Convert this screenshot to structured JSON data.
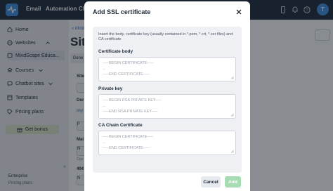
{
  "topbar": {
    "nav": [
      "Email",
      "Automation",
      "Ch"
    ],
    "avatar_initial": "T"
  },
  "sidebar": {
    "items": [
      {
        "label": "Home",
        "icon": "home-icon"
      },
      {
        "label": "Websites",
        "icon": "globe-icon"
      },
      {
        "label": "MindScape Educa...",
        "icon": "site-icon"
      },
      {
        "label": "Courses",
        "icon": "courses-icon"
      },
      {
        "label": "Chatbot sites",
        "icon": "chatbot-icon"
      },
      {
        "label": "Templates",
        "icon": "templates-icon"
      },
      {
        "label": "Pricing plans",
        "icon": "pricing-icon"
      }
    ],
    "bonus_label": "Get bonus",
    "plan_name": "Enterprise",
    "plan_link": "Pricing plans",
    "collapse": "«"
  },
  "main": {
    "breadcrumb": "« Mind",
    "title": "Sit",
    "tab": "Gene",
    "fields": [
      {
        "label": "Site",
        "top": 0
      },
      {
        "label": "Dor"
      },
      {
        "link": "psy"
      },
      {
        "label": "Mai"
      },
      {
        "label": "404"
      }
    ],
    "box_values": [
      "p",
      "N",
      "N"
    ],
    "gray_text": "Ope"
  },
  "modal": {
    "title": "Add SSL certificate",
    "instructions": "Insert the body, certificate key (usually contained in *.pem, *.crt, *.cer files) and CA certificate",
    "fields": [
      {
        "label": "Certificate body",
        "placeholder": "-----BEGIN CERTIFICATE-----\n...\n-----END CERTIFICATE-----"
      },
      {
        "label": "Private key",
        "placeholder": "-----BEGIN RSA PRIVATE KEY-----\n...\n-----END RSA PRIVATE KEY-----"
      },
      {
        "label": "CA Chain Certificate",
        "placeholder": "-----BEGIN CERTIFICATE-----\n...\n-----END CERTIFICATE-----"
      }
    ],
    "cancel_label": "Cancel",
    "add_label": "Add"
  },
  "colors": {
    "topbar": "#1d2a3a",
    "accent_blue": "#3b8fe0",
    "add_button_disabled": "#a5dcb2",
    "bonus_bg": "#dfe6c9"
  }
}
